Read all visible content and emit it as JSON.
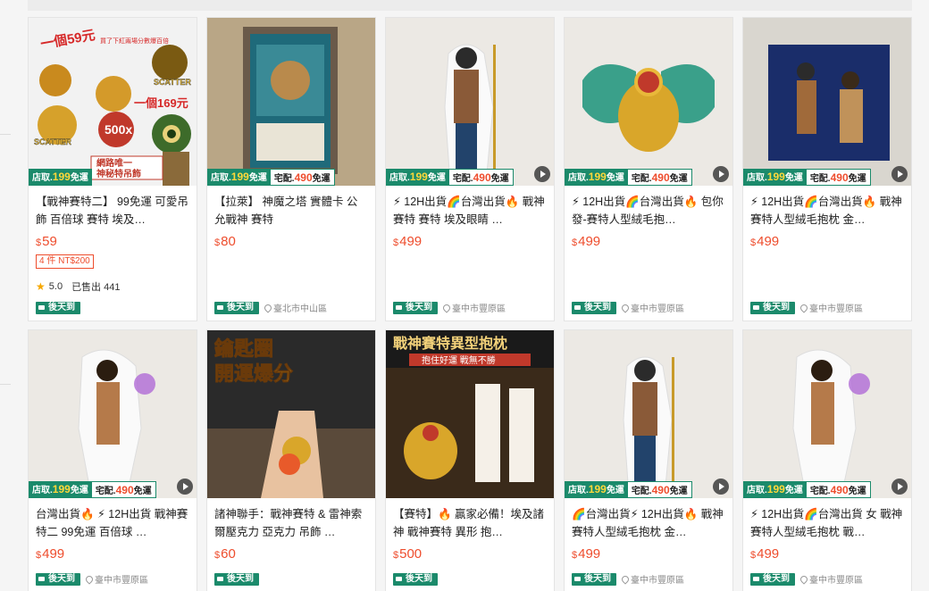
{
  "badges": {
    "store_prefix": "店取.",
    "store_num": "199",
    "store_suffix": "免運",
    "home_prefix": "宅配.",
    "home_num": "490",
    "home_suffix": "免運"
  },
  "ship_label": "後天到",
  "products": [
    {
      "title": "【戰神賽特二】 99免運 可愛吊飾 百倍球 賽特 埃及…",
      "currency": "$",
      "price": "59",
      "promo": "4 件 NT$200",
      "rating": "5.0",
      "sold": "已售出 441",
      "location": "",
      "badges": "store",
      "video": false,
      "art_texts": [
        "一個59元",
        "買了下紅兩場分數爆百倍",
        "SCATTER",
        "一個169元",
        "500x",
        "SCATTER",
        "網路唯一",
        "神秘特吊飾"
      ]
    },
    {
      "title": "【拉萊】 神魔之塔 實體卡 公允戰神 賽特",
      "currency": "$",
      "price": "80",
      "location": "臺北市中山區",
      "badges": "store_home",
      "video": false
    },
    {
      "title": "⚡ 12H出貨🌈台灣出貨🔥 戰神賽特 賽特 埃及眼睛 …",
      "currency": "$",
      "price": "499",
      "location": "臺中市豐原區",
      "badges": "store_home",
      "video": true
    },
    {
      "title": "⚡ 12H出貨🌈台灣出貨🔥 包你發-賽特人型絨毛抱…",
      "currency": "$",
      "price": "499",
      "location": "臺中市豐原區",
      "badges": "store_home",
      "video": true
    },
    {
      "title": "⚡ 12H出貨🌈台灣出貨🔥 戰神賽特人型絨毛抱枕 金…",
      "currency": "$",
      "price": "499",
      "location": "臺中市豐原區",
      "badges": "store_home",
      "video": true
    },
    {
      "title": "台灣出貨🔥 ⚡ 12H出貨 戰神賽特二 99免運 百倍球 …",
      "currency": "$",
      "price": "499",
      "location": "臺中市豐原區",
      "badges": "store_home",
      "video": true
    },
    {
      "title": "諸神聯手：戰神賽特 & 雷神索爾壓克力 亞克力 吊飾 …",
      "currency": "$",
      "price": "60",
      "location": "",
      "badges": "",
      "video": false,
      "art_texts": [
        "鑰匙圈",
        "開運爆分"
      ]
    },
    {
      "title": "【賽特】🔥 贏家必備！埃及諸神 戰神賽特 異形 抱…",
      "currency": "$",
      "price": "500",
      "location": "",
      "badges": "",
      "video": false,
      "art_texts": [
        "戰神賽特異型抱枕",
        "抱住好運 戰無不勝"
      ]
    },
    {
      "title": "🌈台灣出貨⚡ 12H出貨🔥 戰神賽特人型絨毛抱枕 金…",
      "currency": "$",
      "price": "499",
      "location": "臺中市豐原區",
      "badges": "store_home",
      "video": true
    },
    {
      "title": "⚡ 12H出貨🌈台灣出貨 女 戰神賽特人型絨毛抱枕 戰…",
      "currency": "$",
      "price": "499",
      "location": "臺中市豐原區",
      "badges": "store_home",
      "video": true
    }
  ],
  "colors": {
    "accent": "#ee4d2d",
    "ship_green": "#1b8a6b",
    "star": "#f6a700"
  }
}
